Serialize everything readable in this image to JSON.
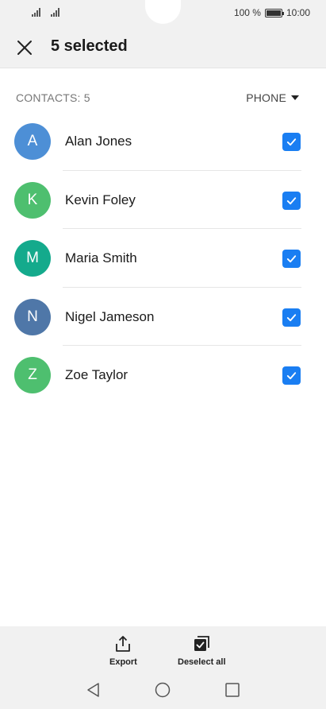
{
  "status_bar": {
    "battery_percent": "100 %",
    "time": "10:00"
  },
  "toolbar": {
    "title": "5 selected"
  },
  "list_header": {
    "count_label": "CONTACTS: 5",
    "sort_label": "PHONE"
  },
  "contacts": [
    {
      "initial": "A",
      "name": "Alan Jones",
      "color": "#4d8fd6",
      "checked": true
    },
    {
      "initial": "K",
      "name": "Kevin Foley",
      "color": "#4ebf6f",
      "checked": true
    },
    {
      "initial": "M",
      "name": "Maria Smith",
      "color": "#14aa8c",
      "checked": true
    },
    {
      "initial": "N",
      "name": "Nigel Jameson",
      "color": "#4f77a8",
      "checked": true
    },
    {
      "initial": "Z",
      "name": "Zoe Taylor",
      "color": "#4ebf6f",
      "checked": true
    }
  ],
  "actions": {
    "export_label": "Export",
    "deselect_label": "Deselect all"
  },
  "colors": {
    "accent": "#1a7ef2",
    "bar_background": "#f1f1f1"
  }
}
